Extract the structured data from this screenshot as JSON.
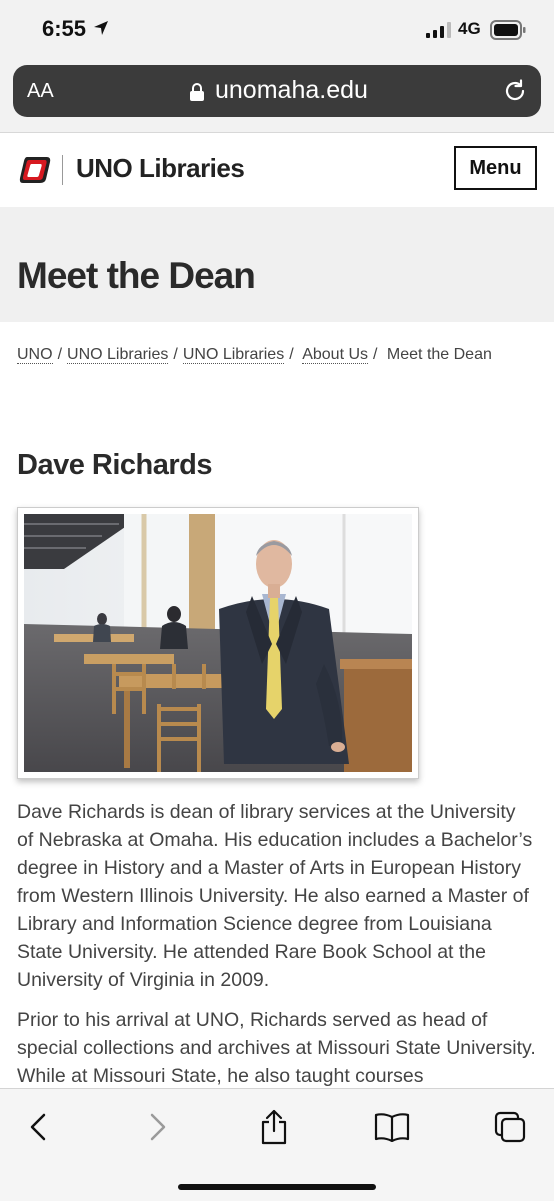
{
  "status": {
    "time": "6:55",
    "network": "4G"
  },
  "browser": {
    "text_size_label": "AA",
    "url": "unomaha.edu"
  },
  "site": {
    "title": "UNO Libraries",
    "menu_label": "Menu"
  },
  "page": {
    "title": "Meet the Dean"
  },
  "breadcrumb": {
    "items": [
      "UNO",
      "UNO Libraries",
      "UNO Libraries",
      "About Us"
    ],
    "current": "Meet the Dean",
    "separator": "/"
  },
  "profile": {
    "name": "Dave Richards",
    "paragraphs": [
      "Dave Richards is dean of library services at the University of Nebraska at Omaha. His education includes a Bachelor’s degree in History and a Master of Arts in European History from Western Illinois University. He also earned a Master of Library and Information Science degree from Louisiana State University. He attended Rare Book School at the University of Virginia in 2009.",
      "Prior to his arrival at UNO, Richards served as head of special collections and archives at Missouri State University. While at Missouri State, he also taught courses"
    ]
  },
  "icons": {
    "back": "chevron-left-icon",
    "forward": "chevron-right-icon",
    "share": "share-icon",
    "bookmarks": "book-icon",
    "tabs": "tabs-icon"
  }
}
